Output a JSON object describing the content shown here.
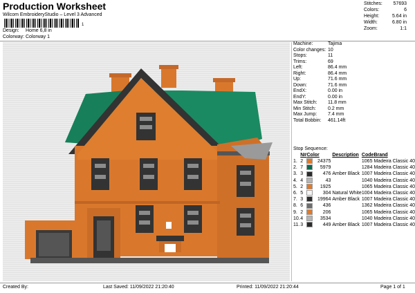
{
  "header": {
    "title": "Production Worksheet",
    "subtitle": "Wilcom EmbroideryStudio – Level 3 Advanced",
    "barcode_number": "1",
    "design_label": "Design:",
    "design_value": "Home 6,8 in",
    "colorway_label": "Colorway:",
    "colorway_value": "Colorway 1"
  },
  "stats": [
    {
      "label": "Stitches:",
      "value": "57693"
    },
    {
      "label": "Colors:",
      "value": "6"
    },
    {
      "label": "Height:",
      "value": "5.64 in"
    },
    {
      "label": "Width:",
      "value": "6.80 in"
    },
    {
      "label": "Zoom:",
      "value": "1:1"
    }
  ],
  "info": [
    {
      "label": "Machine:",
      "value": "Tajima"
    },
    {
      "label": "Color changes:",
      "value": "10"
    },
    {
      "label": "Stops:",
      "value": "11"
    },
    {
      "label": "Trims:",
      "value": "69"
    },
    {
      "label": "Left:",
      "value": "86.4 mm"
    },
    {
      "label": "Right:",
      "value": "86.4 mm"
    },
    {
      "label": "Up:",
      "value": "71.6 mm"
    },
    {
      "label": "Down:",
      "value": "71.6 mm"
    },
    {
      "label": "EndX:",
      "value": "0.00 in"
    },
    {
      "label": "EndY:",
      "value": "0.00 in"
    },
    {
      "label": "Max Stitch:",
      "value": "11.8 mm"
    },
    {
      "label": "Min Stitch:",
      "value": "0.2 mm"
    },
    {
      "label": "Max Jump:",
      "value": "7.4 mm"
    },
    {
      "label": "Total Bobbin:",
      "value": "461.14ft"
    }
  ],
  "sequence": {
    "heading": "Stop Sequence:",
    "columns": {
      "n": "N#",
      "color": "Color",
      "description": "Description",
      "code": "Code",
      "brand": "Brand"
    },
    "rows": [
      {
        "stop": "1.",
        "n": "2",
        "swatch": "#e07a2a",
        "stitches": "24375",
        "description": "",
        "code": "1065",
        "brand": "Madeira Classic 40"
      },
      {
        "stop": "2.",
        "n": "7",
        "swatch": "#0d6b4f",
        "stitches": "5979",
        "description": "",
        "code": "1284",
        "brand": "Madeira Classic 40"
      },
      {
        "stop": "3.",
        "n": "3",
        "swatch": "#2c2c2c",
        "stitches": "476",
        "description": "Amber Black",
        "code": "1007",
        "brand": "Madeira Classic 40"
      },
      {
        "stop": "4.",
        "n": "4",
        "swatch": "#b5b5b5",
        "stitches": "43",
        "description": "",
        "code": "1040",
        "brand": "Madeira Classic 40"
      },
      {
        "stop": "5.",
        "n": "2",
        "swatch": "#e07a2a",
        "stitches": "1925",
        "description": "",
        "code": "1065",
        "brand": "Madeira Classic 40"
      },
      {
        "stop": "6.",
        "n": "5",
        "swatch": "#f4f4f4",
        "stitches": "304",
        "description": "Natural White",
        "code": "1004",
        "brand": "Madeira Classic 40"
      },
      {
        "stop": "7.",
        "n": "3",
        "swatch": "#2c2c2c",
        "stitches": "19964",
        "description": "Amber Black",
        "code": "1007",
        "brand": "Madeira Classic 40"
      },
      {
        "stop": "8.",
        "n": "6",
        "swatch": "#6e6e6e",
        "stitches": "436",
        "description": "",
        "code": "1362",
        "brand": "Madeira Classic 40"
      },
      {
        "stop": "9.",
        "n": "2",
        "swatch": "#e07a2a",
        "stitches": "206",
        "description": "",
        "code": "1065",
        "brand": "Madeira Classic 40"
      },
      {
        "stop": "10.",
        "n": "4",
        "swatch": "#b5b5b5",
        "stitches": "3534",
        "description": "",
        "code": "1040",
        "brand": "Madeira Classic 40"
      },
      {
        "stop": "11.",
        "n": "3",
        "swatch": "#2c2c2c",
        "stitches": "449",
        "description": "Amber Black",
        "code": "1007",
        "brand": "Madeira Classic 40"
      }
    ]
  },
  "footer": {
    "created_by": "Created By:",
    "last_saved": "Last Saved: 11/09/2022 21:20:40",
    "printed": "Printed: 11/09/2022 21:20:44",
    "page": "Page 1 of 1"
  }
}
